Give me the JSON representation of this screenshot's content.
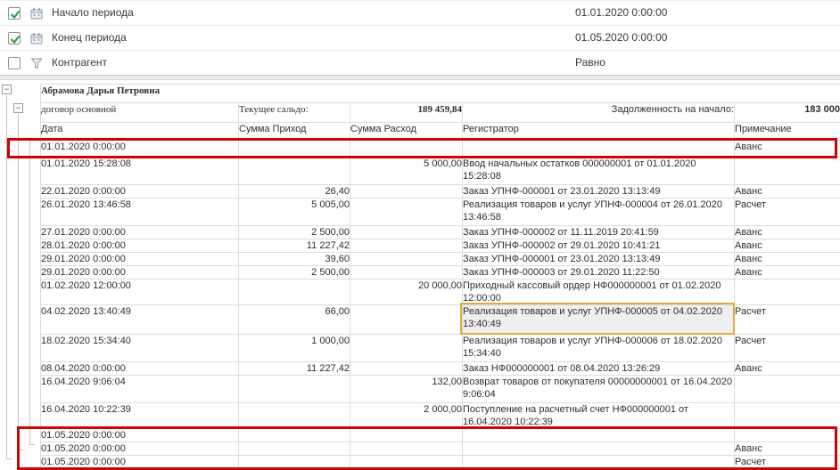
{
  "colors": {
    "red_highlight": "#d40000",
    "orange_highlight": "#e7a83e",
    "check_green": "#2f9e44",
    "selected_cell_bg": "#efefef"
  },
  "icons": {
    "collapse": "−"
  },
  "filters": {
    "rows": [
      {
        "label": "Начало периода",
        "value": "01.01.2020 0:00:00",
        "checked": true,
        "icon": "calendar-icon"
      },
      {
        "label": "Конец периода",
        "value": "01.05.2020 0:00:00",
        "checked": true,
        "icon": "calendar-icon"
      },
      {
        "label": "Контрагент",
        "value": "Равно",
        "checked": false,
        "icon": "filter-funnel-icon"
      }
    ]
  },
  "report": {
    "group_title": "Абрамова Дарья Петровна",
    "subgroup": {
      "label": "договор основной",
      "current_balance_label": "Текущее сальдо:",
      "current_balance": "189 459,84",
      "opening_debt_label": "Задолженность на начало:",
      "opening_debt": "183 000"
    },
    "columns": [
      "Дата",
      "Сумма Приход",
      "Сумма Расход",
      "Регистратор",
      "Примечание"
    ],
    "rows": [
      {
        "date": "01.01.2020 0:00:00",
        "prihod": "",
        "rashod": "",
        "registrator": "",
        "note": "Аванс"
      },
      {
        "date": "01.01.2020 15:28:08",
        "prihod": "",
        "rashod": "5 000,00",
        "registrator": "Ввод начальных остатков 000000001 от 01.01.2020 15:28:08",
        "note": ""
      },
      {
        "date": "22.01.2020 0:00:00",
        "prihod": "26,40",
        "rashod": "",
        "registrator": "Заказ УПНФ-000001 от 23.01.2020 13:13:49",
        "note": "Аванс"
      },
      {
        "date": "26.01.2020 13:46:58",
        "prihod": "5 005,00",
        "rashod": "",
        "registrator": "Реализация товаров и услуг УПНФ-000004 от 26.01.2020 13:46:58",
        "note": "Расчет"
      },
      {
        "date": "27.01.2020 0:00:00",
        "prihod": "2 500,00",
        "rashod": "",
        "registrator": "Заказ УПНФ-000002 от 11.11.2019 20:41:59",
        "note": "Аванс"
      },
      {
        "date": "28.01.2020 0:00:00",
        "prihod": "11 227,42",
        "rashod": "",
        "registrator": "Заказ УПНФ-000002 от 29.01.2020 10:41:21",
        "note": "Аванс"
      },
      {
        "date": "29.01.2020 0:00:00",
        "prihod": "39,60",
        "rashod": "",
        "registrator": "Заказ УПНФ-000001 от 23.01.2020 13:13:49",
        "note": "Аванс"
      },
      {
        "date": "29.01.2020 0:00:00",
        "prihod": "2 500,00",
        "rashod": "",
        "registrator": "Заказ УПНФ-000003 от 29.01.2020 11:22:50",
        "note": "Аванс"
      },
      {
        "date": "01.02.2020 12:00:00",
        "prihod": "",
        "rashod": "20 000,00",
        "registrator": "Приходный кассовый ордер НФ000000001 от 01.02.2020 12:00:00",
        "note": ""
      },
      {
        "date": "04.02.2020 13:40:49",
        "prihod": "66,00",
        "rashod": "",
        "registrator": "Реализация товаров и услуг УПНФ-000005 от 04.02.2020 13:40:49",
        "note": "Расчет"
      },
      {
        "date": "18.02.2020 15:34:40",
        "prihod": "1 000,00",
        "rashod": "",
        "registrator": "Реализация товаров и услуг УПНФ-000006 от 18.02.2020 15:34:40",
        "note": "Расчет"
      },
      {
        "date": "08.04.2020 0:00:00",
        "prihod": "11 227,42",
        "rashod": "",
        "registrator": "Заказ НФ000000001 от 08.04.2020 13:26:29",
        "note": "Аванс"
      },
      {
        "date": "16.04.2020 9:06:04",
        "prihod": "",
        "rashod": "132,00",
        "registrator": "Возврат товаров от покупателя 00000000001 от 16.04.2020 9:06:04",
        "note": ""
      },
      {
        "date": "16.04.2020 10:22:39",
        "prihod": "",
        "rashod": "2 000,00",
        "registrator": "Поступление на расчетный счет НФ000000001 от 16.04.2020 10:22:39",
        "note": ""
      },
      {
        "date": "01.05.2020 0:00:00",
        "prihod": "",
        "rashod": "",
        "registrator": "",
        "note": ""
      },
      {
        "date": "01.05.2020 0:00:00",
        "prihod": "",
        "rashod": "",
        "registrator": "",
        "note": "Аванс"
      },
      {
        "date": "01.05.2020 0:00:00",
        "prihod": "",
        "rashod": "",
        "registrator": "",
        "note": "Расчет"
      }
    ]
  },
  "annotations": {
    "red_box_1_rows": [
      0,
      0
    ],
    "red_box_2_rows": [
      14,
      16
    ],
    "selected_cell": {
      "row_index": 9,
      "column": "Регистратор",
      "column_index": 3
    }
  }
}
